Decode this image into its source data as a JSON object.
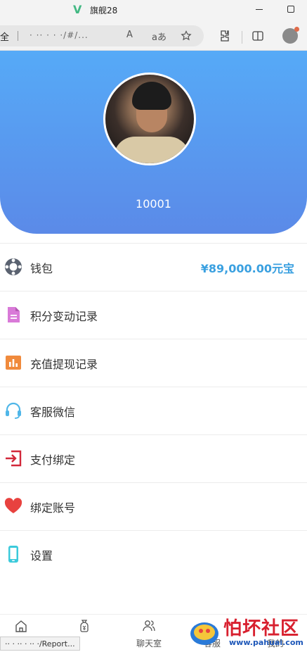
{
  "window": {
    "title": "旗舰28",
    "logo_glyph": "V"
  },
  "browser": {
    "security_label": "全",
    "url": "· ·· · · ·/#/...",
    "read_aloud_label": "A",
    "translate_label": "aあ"
  },
  "profile": {
    "username": "10001"
  },
  "menu": {
    "items": [
      {
        "label": "钱包",
        "value": "¥89,000.00元宝",
        "icon": "lifebuoy-icon"
      },
      {
        "label": "积分变动记录",
        "icon": "document-icon"
      },
      {
        "label": "充值提现记录",
        "icon": "bar-chart-icon"
      },
      {
        "label": "客服微信",
        "icon": "headset-icon"
      },
      {
        "label": "支付绑定",
        "icon": "login-icon"
      },
      {
        "label": "绑定账号",
        "icon": "heart-icon"
      },
      {
        "label": "设置",
        "icon": "phone-icon"
      }
    ]
  },
  "bottom_nav": {
    "items": [
      {
        "label": "",
        "icon": "home-icon"
      },
      {
        "label": "",
        "icon": "money-bag-icon"
      },
      {
        "label": "聊天室",
        "icon": "users-icon"
      },
      {
        "label": "客服",
        "icon": "service-icon"
      },
      {
        "label": "我的",
        "icon": "user-icon"
      }
    ]
  },
  "status_bar": {
    "url_text": "·· · ·· · ·· ·/Report..."
  },
  "watermark": {
    "title": "怕坏社区",
    "url": "www.pahuai.com"
  },
  "colors": {
    "header_top": "#56aaf7",
    "header_bottom": "#5b8ae8",
    "wallet_value": "#3aa0e0"
  }
}
